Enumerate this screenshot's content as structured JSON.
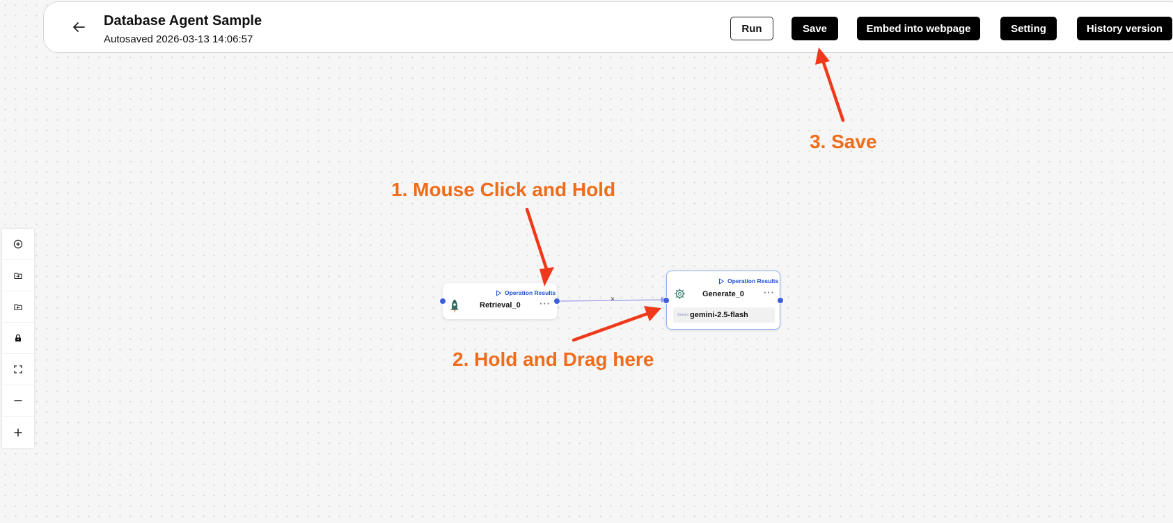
{
  "header": {
    "title": "Database Agent Sample",
    "autosave": "Autosaved 2026-03-13 14:06:57",
    "buttons": {
      "run": "Run",
      "save": "Save",
      "embed": "Embed into webpage",
      "setting": "Setting",
      "history": "History version"
    }
  },
  "toolbar": {
    "icons": [
      "add-circle-icon",
      "import-icon",
      "export-icon",
      "lock-icon",
      "fullscreen-icon",
      "zoom-out-icon",
      "zoom-in-icon"
    ]
  },
  "nodes": {
    "retrieval": {
      "name": "Retrieval_0",
      "results_label": "Operation Results",
      "menu": "···",
      "icon": "rocket-icon"
    },
    "generate": {
      "name": "Generate_0",
      "results_label": "Operation Results",
      "menu": "···",
      "icon": "gear-icon",
      "model": "gemini-2.5-flash",
      "model_logo": "Gemini"
    }
  },
  "edge": {
    "label": "×"
  },
  "annotations": {
    "step1": "1. Mouse Click and Hold",
    "step2": "2. Hold and Drag here",
    "step3": "3. Save"
  },
  "colors": {
    "accent": "#1c4fd0",
    "annotation": "#ef6c1a",
    "arrow": "#f0391a",
    "handle": "#3d5fd9"
  }
}
